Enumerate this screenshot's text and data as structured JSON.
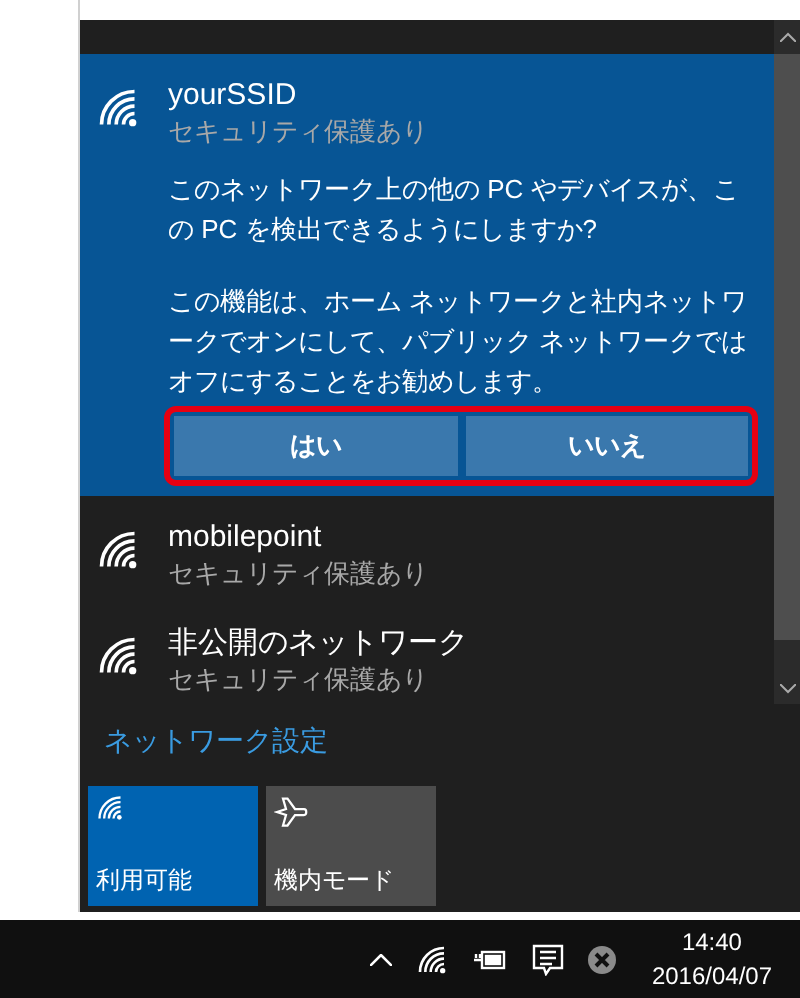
{
  "networks": [
    {
      "name": "yourSSID",
      "security": "セキュリティ保護あり",
      "selected": true,
      "prompt": "このネットワーク上の他の PC やデバイスが、この PC を検出できるようにしますか?",
      "note": "この機能は、ホーム ネットワークと社内ネットワークでオンにして、パブリック ネットワークではオフにすることをお勧めします。",
      "buttons": [
        "はい",
        "いいえ"
      ]
    },
    {
      "name": "mobilepoint",
      "security": "セキュリティ保護あり",
      "selected": false
    },
    {
      "name": "非公開のネットワーク",
      "security": "セキュリティ保護あり",
      "selected": false
    }
  ],
  "settings_link": "ネットワーク設定",
  "tiles": [
    {
      "kind": "wifi",
      "label": "利用可能",
      "selected": true
    },
    {
      "kind": "airplane",
      "label": "機内モード",
      "selected": false
    }
  ],
  "taskbar": {
    "time": "14:40",
    "date": "2016/04/07"
  }
}
